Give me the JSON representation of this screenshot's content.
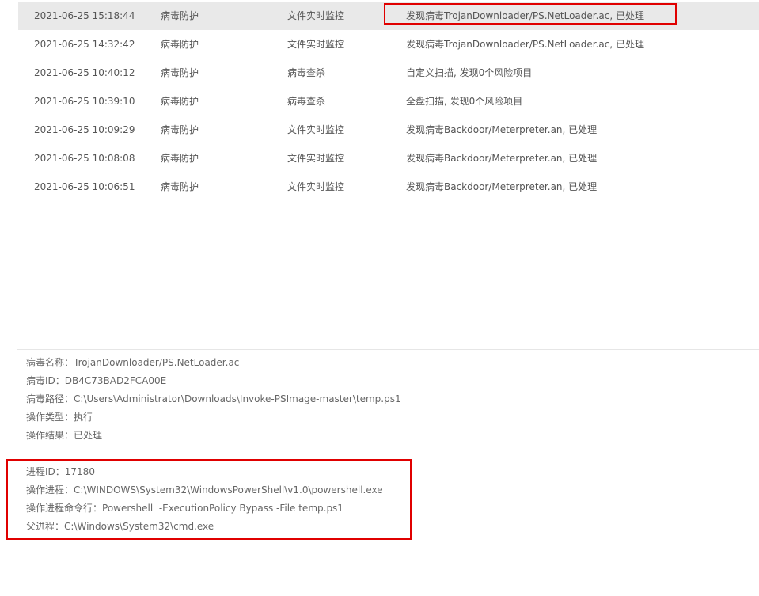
{
  "events": [
    {
      "time": "2021-06-25 15:18:44",
      "category": "病毒防护",
      "source": "文件实时监控",
      "desc": "发现病毒TrojanDownloader/PS.NetLoader.ac, 已处理"
    },
    {
      "time": "2021-06-25 14:32:42",
      "category": "病毒防护",
      "source": "文件实时监控",
      "desc": "发现病毒TrojanDownloader/PS.NetLoader.ac, 已处理"
    },
    {
      "time": "2021-06-25 10:40:12",
      "category": "病毒防护",
      "source": "病毒查杀",
      "desc": "自定义扫描, 发现0个风险项目"
    },
    {
      "time": "2021-06-25 10:39:10",
      "category": "病毒防护",
      "source": "病毒查杀",
      "desc": "全盘扫描, 发现0个风险项目"
    },
    {
      "time": "2021-06-25 10:09:29",
      "category": "病毒防护",
      "source": "文件实时监控",
      "desc": "发现病毒Backdoor/Meterpreter.an, 已处理"
    },
    {
      "time": "2021-06-25 10:08:08",
      "category": "病毒防护",
      "source": "文件实时监控",
      "desc": "发现病毒Backdoor/Meterpreter.an, 已处理"
    },
    {
      "time": "2021-06-25 10:06:51",
      "category": "病毒防护",
      "source": "文件实时监控",
      "desc": "发现病毒Backdoor/Meterpreter.an, 已处理"
    }
  ],
  "details": {
    "virus_name_label": "病毒名称：",
    "virus_name": "TrojanDownloader/PS.NetLoader.ac",
    "virus_id_label": "病毒ID：",
    "virus_id": "DB4C73BAD2FCA00E",
    "virus_path_label": "病毒路径：",
    "virus_path": "C:\\Users\\Administrator\\Downloads\\Invoke-PSImage-master\\temp.ps1",
    "op_type_label": "操作类型：",
    "op_type": "执行",
    "op_result_label": "操作结果：",
    "op_result": "已处理",
    "pid_label": "进程ID：",
    "pid": "17180",
    "op_process_label": "操作进程：",
    "op_process": "C:\\WINDOWS\\System32\\WindowsPowerShell\\v1.0\\powershell.exe",
    "cmdline_label": "操作进程命令行：",
    "cmdline": "Powershell  -ExecutionPolicy Bypass -File temp.ps1",
    "parent_label": "父进程：",
    "parent": "C:\\Windows\\System32\\cmd.exe"
  },
  "colors": {
    "highlight": "#e00000",
    "selected_row": "#e9e9e9"
  }
}
